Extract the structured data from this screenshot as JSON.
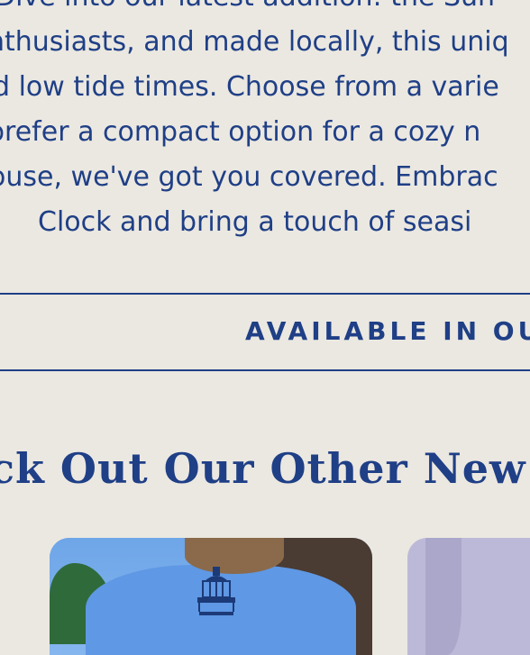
{
  "description": {
    "lines": [
      "Dive into our latest addition: the Sun",
      "nthusiasts, and made locally, this uniq",
      "d low tide times. Choose from a varie",
      "prefer a compact option for a cozy n",
      "ouse, we've got you covered. Embrac",
      "Clock and bring a touch of seasi"
    ]
  },
  "banner": {
    "text": "AVAILABLE IN OU"
  },
  "section": {
    "heading": "ck Out Our Other New"
  },
  "colors": {
    "background": "#ebe8e1",
    "accent": "#1f3f86"
  },
  "products": [
    {
      "image": "blue-lighthouse-shirt"
    },
    {
      "image": "lavender-shirt"
    }
  ]
}
